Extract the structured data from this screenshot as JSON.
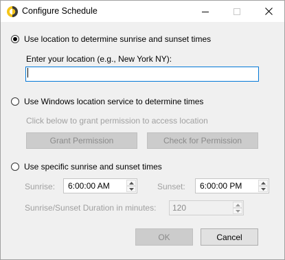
{
  "window": {
    "title": "Configure Schedule",
    "minimize_icon": "minimize-icon",
    "maximize_icon": "maximize-icon",
    "close_icon": "close-icon"
  },
  "option_location": {
    "label": "Use location to determine sunrise and sunset times",
    "selected": true,
    "prompt": "Enter your location (e.g., New York NY):",
    "value": ""
  },
  "option_windows": {
    "label": "Use Windows location service to determine times",
    "note": "Click below to grant permission to access location",
    "grant_button": "Grant Permission",
    "check_button": "Check for Permission"
  },
  "option_specific": {
    "label": "Use specific sunrise and sunset times",
    "sunrise_label": "Sunrise:",
    "sunrise_value": "6:00:00 AM",
    "sunset_label": "Sunset:",
    "sunset_value": "6:00:00 PM",
    "duration_label": "Sunrise/Sunset Duration in minutes:",
    "duration_value": "120"
  },
  "footer": {
    "ok_label": "OK",
    "cancel_label": "Cancel"
  },
  "colors": {
    "accent_border": "#0078d7",
    "disabled_text": "#a0a0a0"
  }
}
